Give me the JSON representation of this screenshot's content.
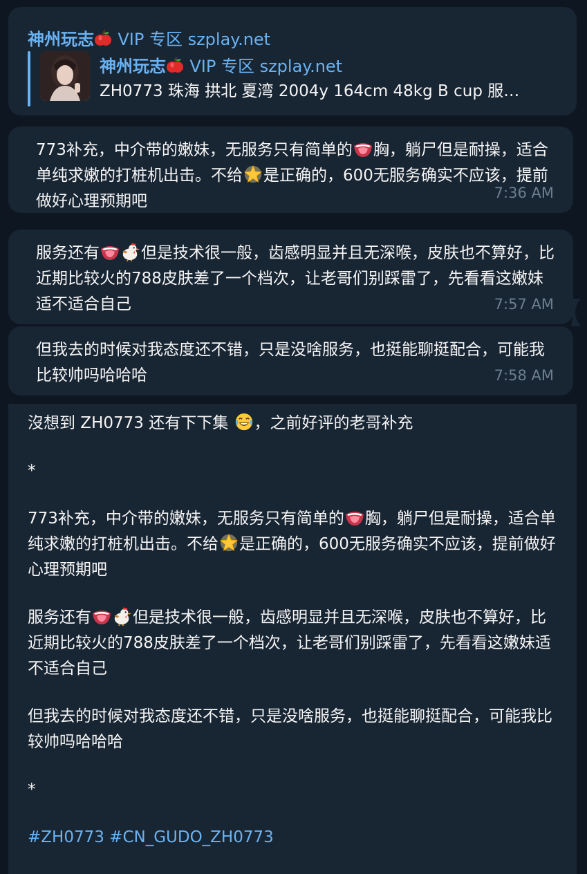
{
  "channel": {
    "name": "神州玩志",
    "suffix": "VIP 专区 szplay.net"
  },
  "reply": {
    "title": "神州玩志",
    "title_suffix": "VIP 专区 szplay.net",
    "text": "ZH0773 珠海 拱北 夏湾 2004y  164cm  48kg  B cup  服…"
  },
  "messages": [
    {
      "parts": [
        "773补充，中介带的嫩妹，无服务只有简单的",
        "胸，躺尸但是耐操，适合单纯求嫩的打桩机出击。不给",
        "是正确的，600无服务确实不应该，提前做好心理预期吧"
      ],
      "time": "7:36 AM"
    },
    {
      "parts": [
        "服务还有",
        "但是技术很一般，齿感明显并且无深喉，皮肤也不算好，比近期比较火的788皮肤差了一个档次，让老哥们别踩雷了，先看看这嫩妹适不适合自己"
      ],
      "time": "7:57 AM"
    },
    {
      "parts": [
        "但我去的时候对我态度还不错，只是没啥服务，也挺能聊挺配合，可能我比较帅吗哈哈哈"
      ],
      "time": "7:58 AM"
    }
  ],
  "post": {
    "intro": [
      "沒想到 ZH0773 还有下下集 ",
      "，之前好评的老哥补充"
    ],
    "star1": "*",
    "p1": [
      "773补充，中介带的嫩妹，无服务只有简单的",
      "胸，躺尸但是耐操，适合单纯求嫩的打桩机出击。不给",
      "是正确的，600无服务确实不应该，提前做好心理预期吧"
    ],
    "p2": [
      "服务还有",
      "但是技术很一般，齿感明显并且无深喉，皮肤也不算好，比近期比较火的788皮肤差了一个档次，让老哥们别踩雷了，先看看这嫩妹适不适合自己"
    ],
    "p3": "但我去的时候对我态度还不错，只是没啥服务，也挺能聊挺配合，可能我比较帅吗哈哈哈",
    "star2": "*",
    "hashtags": [
      "#ZH0773",
      "#CN_GUDO_ZH0773"
    ]
  },
  "colors": {
    "background": "#0e1621",
    "bubble": "#182533",
    "link": "#6ab3f3",
    "time": "#6d7f8f"
  }
}
